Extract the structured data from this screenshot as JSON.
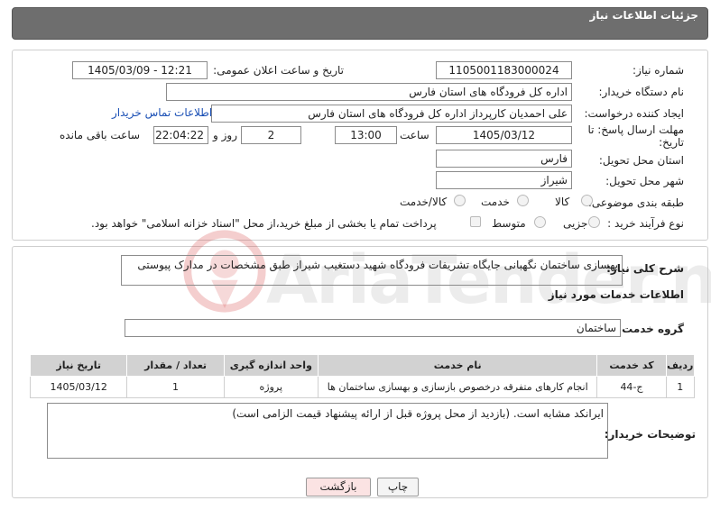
{
  "header": {
    "title": "جزئیات اطلاعات نیاز"
  },
  "fields": {
    "need_number_label": "شماره نیاز:",
    "need_number": "1105001183000024",
    "announce_label": "تاریخ و ساعت اعلان عمومی:",
    "announce_value": "1405/03/09 - 12:21",
    "buyer_org_label": "نام دستگاه خریدار:",
    "buyer_org": "اداره کل فرودگاه های استان فارس",
    "creator_label": "ایجاد کننده درخواست:",
    "creator": "علی  احمدیان کارپرداز اداره کل فرودگاه های استان فارس",
    "contact_link": "اطلاعات تماس خریدار",
    "deadline_label": "مهلت ارسال پاسخ: تا",
    "deadline_label2": "تاریخ:",
    "deadline_date": "1405/03/12",
    "time_label": "ساعت",
    "deadline_time": "13:00",
    "days_value": "2",
    "days_label": "روز و",
    "remaining_time": "22:04:22",
    "remaining_label": "ساعت باقی مانده",
    "province_label": "استان محل تحویل:",
    "province": "فارس",
    "city_label": "شهر محل تحویل:",
    "city": "شیراز",
    "category_label": "طبقه بندی موضوعی:",
    "category_options": [
      "کالا",
      "خدمت",
      "کالا/خدمت"
    ],
    "process_label": "نوع فرآیند خرید :",
    "process_options": [
      "جزیی",
      "متوسط"
    ],
    "payment_note": "پرداخت تمام یا بخشی از مبلغ خرید،از محل \"اسناد خزانه اسلامی\" خواهد بود."
  },
  "description": {
    "label": "شرح کلی نیاز:",
    "text": "بهسازی ساختمان نگهبانی جایگاه تشریفات فرودگاه شهید دستغیب شیراز طبق مشخصات در مدارک پیوستی"
  },
  "services": {
    "section_title": "اطلاعات خدمات مورد نیاز",
    "group_label": "گروه خدمت:",
    "group_value": "ساختمان",
    "columns": [
      "ردیف",
      "کد خدمت",
      "نام خدمت",
      "واحد اندازه گیری",
      "تعداد / مقدار",
      "تاریخ نیاز"
    ],
    "rows": [
      [
        "1",
        "ج-44",
        "انجام کارهای متفرقه درخصوص بازسازی و بهسازی ساختمان ها",
        "پروژه",
        "1",
        "1405/03/12"
      ]
    ]
  },
  "buyer_notes": {
    "label": "توضیحات خریدار:",
    "text": "ایرانکد مشابه است. (بازدید از محل پروژه قبل از ارائه پیشنهاد قیمت الزامی است)"
  },
  "buttons": {
    "print": "چاپ",
    "back": "بازگشت"
  },
  "watermark": {
    "text": "AriaTender.neT"
  },
  "colors": {
    "header_bg": "#6e6e6e",
    "link": "#1a4fb5",
    "back_button_bg": "#fbe3e3",
    "table_header_bg": "#d2d2d2"
  }
}
